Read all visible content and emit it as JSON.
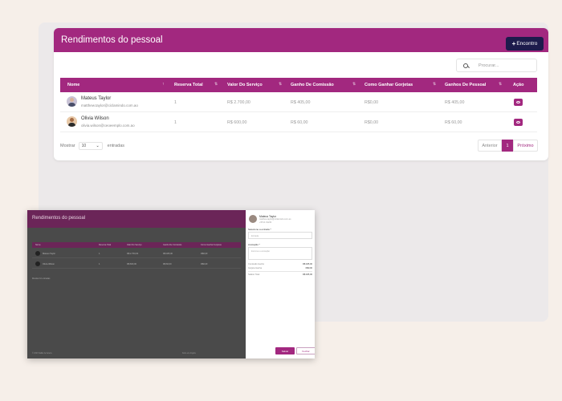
{
  "page": {
    "title": "Rendimentos do pessoal",
    "add_button": "Encontro",
    "search_placeholder": "Procurar..."
  },
  "table": {
    "headers": [
      "Nome",
      "Reserva Total",
      "Valor Do Serviço",
      "Ganho De Comissão",
      "Como Ganhar Gorjetas",
      "Ganhos De Pessoal",
      "Ação"
    ],
    "rows": [
      {
        "name": "Mateus Taylor",
        "email": "matthew.taylor@ciclamindo.com.ao",
        "reserva": "1",
        "valor": "R$ 2.700,00",
        "comissao": "R$ 405,00",
        "gorjetas": "R$0,00",
        "ganhos": "R$ 405,00"
      },
      {
        "name": "Olivia Wilson",
        "email": "olivia.wilson@ceoeemplo.com.ao",
        "reserva": "1",
        "valor": "R$ 600,00",
        "comissao": "R$ 60,00",
        "gorjetas": "R$0,00",
        "ganhos": "R$ 60,00"
      }
    ]
  },
  "footer": {
    "show_label": "Mostrar",
    "length_value": "10",
    "entries_label": "entradas",
    "prev": "Anterior",
    "page": "1",
    "next": "Próximo"
  },
  "inset": {
    "title": "Rendimentos do pessoal",
    "headers": [
      "Nome",
      "Reserva Total",
      "Valor Do Serviço",
      "Ganho De Comissão",
      "Como Ganhar Gorjetas"
    ],
    "rows": [
      {
        "name": "Mateus Taylor",
        "cells": [
          "1",
          "R$ 2.700,00",
          "R$ 405,00",
          "R$0,00"
        ]
      },
      {
        "name": "Olivia Wilson",
        "cells": [
          "1",
          "R$ 600,00",
          "R$ 60,00",
          "R$0,00"
        ]
      }
    ],
    "show": "Mostrar 10 entradas",
    "footer_left": "© 2023 Salão de beleza",
    "footer_right": "Feito em Angola",
    "panel": {
      "name": "Mateus Taylor",
      "email": "matthew.taylor@ciclamindo.com.ao",
      "phone": "+55 11 91234",
      "label1": "Selecione a entrada *",
      "input1": "Entrada",
      "label2": "Anotação *",
      "input2": "Escreva a anotação",
      "rows": [
        {
          "label": "Comissão Ganho",
          "value": "R$ 405,00"
        },
        {
          "label": "Gorjeta Ganha",
          "value": "R$0,00"
        },
        {
          "label": "Salário Total",
          "value": "R$ 405,00"
        }
      ],
      "save": "Salvar",
      "close": "Fechar"
    }
  },
  "colors": {
    "brand": "#a2287f",
    "dark_button": "#1d1b4c",
    "background": "#f6efe9"
  }
}
